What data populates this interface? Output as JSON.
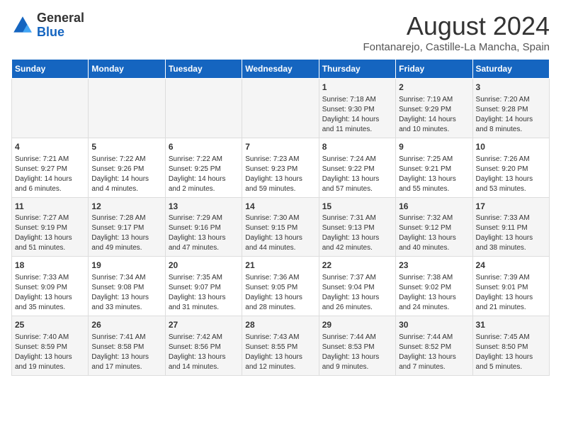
{
  "header": {
    "logo_general": "General",
    "logo_blue": "Blue",
    "month_title": "August 2024",
    "location": "Fontanarejo, Castille-La Mancha, Spain"
  },
  "days_of_week": [
    "Sunday",
    "Monday",
    "Tuesday",
    "Wednesday",
    "Thursday",
    "Friday",
    "Saturday"
  ],
  "weeks": [
    [
      {
        "num": "",
        "info": ""
      },
      {
        "num": "",
        "info": ""
      },
      {
        "num": "",
        "info": ""
      },
      {
        "num": "",
        "info": ""
      },
      {
        "num": "1",
        "info": "Sunrise: 7:18 AM\nSunset: 9:30 PM\nDaylight: 14 hours and 11 minutes."
      },
      {
        "num": "2",
        "info": "Sunrise: 7:19 AM\nSunset: 9:29 PM\nDaylight: 14 hours and 10 minutes."
      },
      {
        "num": "3",
        "info": "Sunrise: 7:20 AM\nSunset: 9:28 PM\nDaylight: 14 hours and 8 minutes."
      }
    ],
    [
      {
        "num": "4",
        "info": "Sunrise: 7:21 AM\nSunset: 9:27 PM\nDaylight: 14 hours and 6 minutes."
      },
      {
        "num": "5",
        "info": "Sunrise: 7:22 AM\nSunset: 9:26 PM\nDaylight: 14 hours and 4 minutes."
      },
      {
        "num": "6",
        "info": "Sunrise: 7:22 AM\nSunset: 9:25 PM\nDaylight: 14 hours and 2 minutes."
      },
      {
        "num": "7",
        "info": "Sunrise: 7:23 AM\nSunset: 9:23 PM\nDaylight: 13 hours and 59 minutes."
      },
      {
        "num": "8",
        "info": "Sunrise: 7:24 AM\nSunset: 9:22 PM\nDaylight: 13 hours and 57 minutes."
      },
      {
        "num": "9",
        "info": "Sunrise: 7:25 AM\nSunset: 9:21 PM\nDaylight: 13 hours and 55 minutes."
      },
      {
        "num": "10",
        "info": "Sunrise: 7:26 AM\nSunset: 9:20 PM\nDaylight: 13 hours and 53 minutes."
      }
    ],
    [
      {
        "num": "11",
        "info": "Sunrise: 7:27 AM\nSunset: 9:19 PM\nDaylight: 13 hours and 51 minutes."
      },
      {
        "num": "12",
        "info": "Sunrise: 7:28 AM\nSunset: 9:17 PM\nDaylight: 13 hours and 49 minutes."
      },
      {
        "num": "13",
        "info": "Sunrise: 7:29 AM\nSunset: 9:16 PM\nDaylight: 13 hours and 47 minutes."
      },
      {
        "num": "14",
        "info": "Sunrise: 7:30 AM\nSunset: 9:15 PM\nDaylight: 13 hours and 44 minutes."
      },
      {
        "num": "15",
        "info": "Sunrise: 7:31 AM\nSunset: 9:13 PM\nDaylight: 13 hours and 42 minutes."
      },
      {
        "num": "16",
        "info": "Sunrise: 7:32 AM\nSunset: 9:12 PM\nDaylight: 13 hours and 40 minutes."
      },
      {
        "num": "17",
        "info": "Sunrise: 7:33 AM\nSunset: 9:11 PM\nDaylight: 13 hours and 38 minutes."
      }
    ],
    [
      {
        "num": "18",
        "info": "Sunrise: 7:33 AM\nSunset: 9:09 PM\nDaylight: 13 hours and 35 minutes."
      },
      {
        "num": "19",
        "info": "Sunrise: 7:34 AM\nSunset: 9:08 PM\nDaylight: 13 hours and 33 minutes."
      },
      {
        "num": "20",
        "info": "Sunrise: 7:35 AM\nSunset: 9:07 PM\nDaylight: 13 hours and 31 minutes."
      },
      {
        "num": "21",
        "info": "Sunrise: 7:36 AM\nSunset: 9:05 PM\nDaylight: 13 hours and 28 minutes."
      },
      {
        "num": "22",
        "info": "Sunrise: 7:37 AM\nSunset: 9:04 PM\nDaylight: 13 hours and 26 minutes."
      },
      {
        "num": "23",
        "info": "Sunrise: 7:38 AM\nSunset: 9:02 PM\nDaylight: 13 hours and 24 minutes."
      },
      {
        "num": "24",
        "info": "Sunrise: 7:39 AM\nSunset: 9:01 PM\nDaylight: 13 hours and 21 minutes."
      }
    ],
    [
      {
        "num": "25",
        "info": "Sunrise: 7:40 AM\nSunset: 8:59 PM\nDaylight: 13 hours and 19 minutes."
      },
      {
        "num": "26",
        "info": "Sunrise: 7:41 AM\nSunset: 8:58 PM\nDaylight: 13 hours and 17 minutes."
      },
      {
        "num": "27",
        "info": "Sunrise: 7:42 AM\nSunset: 8:56 PM\nDaylight: 13 hours and 14 minutes."
      },
      {
        "num": "28",
        "info": "Sunrise: 7:43 AM\nSunset: 8:55 PM\nDaylight: 13 hours and 12 minutes."
      },
      {
        "num": "29",
        "info": "Sunrise: 7:44 AM\nSunset: 8:53 PM\nDaylight: 13 hours and 9 minutes."
      },
      {
        "num": "30",
        "info": "Sunrise: 7:44 AM\nSunset: 8:52 PM\nDaylight: 13 hours and 7 minutes."
      },
      {
        "num": "31",
        "info": "Sunrise: 7:45 AM\nSunset: 8:50 PM\nDaylight: 13 hours and 5 minutes."
      }
    ]
  ]
}
